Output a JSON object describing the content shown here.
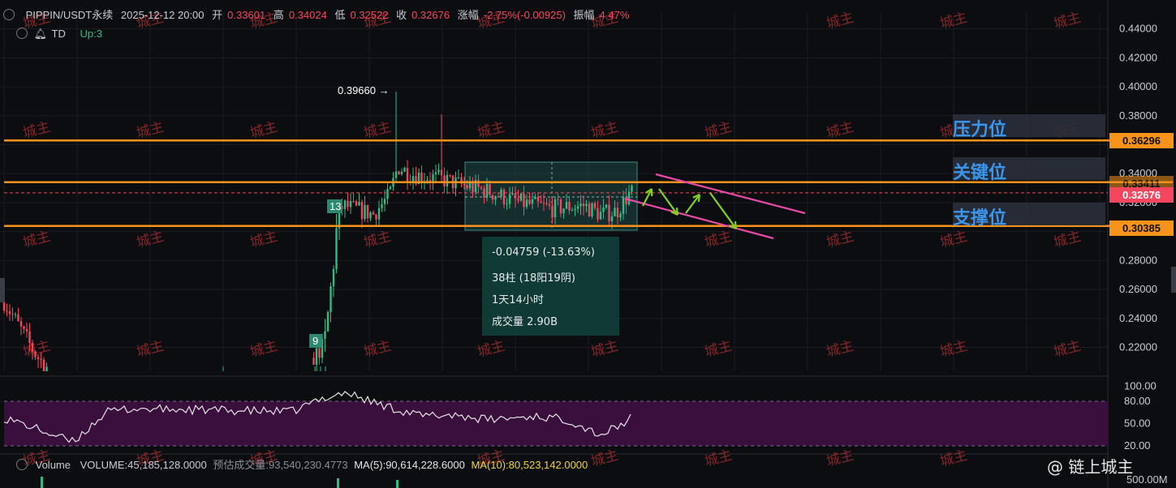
{
  "header": {
    "symbol": "PIPPIN/USDT永续",
    "datetime": "2025-12-12 20:00",
    "open_label": "开",
    "open": "0.33601",
    "high_label": "高",
    "high": "0.34024",
    "low_label": "低",
    "low": "0.32522",
    "close_label": "收",
    "close": "0.32676",
    "change_label": "涨幅",
    "change": "-2.75%(-0.00925)",
    "amp_label": "振幅",
    "amp": "4.47%"
  },
  "indicator_row": {
    "td_label": "TD",
    "td_value": "Up:3"
  },
  "stats_box": {
    "line1": "-0.04759 (-13.63%)",
    "line2": "38柱 (18阳19阴)",
    "line3": "1天14小时",
    "line4": "成交量 2.90B"
  },
  "levels": {
    "resistance_label": "压力位",
    "key_label": "关键位",
    "support_label": "支撑位",
    "resistance_price": "0.36296",
    "key_price": "0.33411",
    "current_price": "0.32676",
    "support_price": "0.30385"
  },
  "annotations": {
    "high_marker": "0.39660 →",
    "td_13": "13",
    "td_9": "9"
  },
  "volume_row": {
    "volume_label": "Volume",
    "volume_value": "VOLUME:45,185,128.0000",
    "forecast_label": "预估成交量:93,540,230.4773",
    "ma5": "MA(5):90,614,228.6000",
    "ma10": "MA(10):80,523,142.0000",
    "vol_axis": "500.00M"
  },
  "watermark": "城主",
  "brand": "@ 链上城主",
  "colors": {
    "up": "#2ebd85",
    "down": "#f6465d",
    "level": "#f7931a",
    "label_text": "#3ea2ff",
    "trend": "#e94aa8",
    "arrow": "#7fd321",
    "rsi_bg": "#3b0f3d"
  },
  "chart_data": {
    "type": "candlestick",
    "y_axis_ticks": [
      "0.44000",
      "0.42000",
      "0.40000",
      "0.38000",
      "0.36000",
      "0.34000",
      "0.32000",
      "0.30000",
      "0.28000",
      "0.26000",
      "0.24000",
      "0.22000"
    ],
    "ylim": [
      0.2035,
      0.451
    ],
    "rsi_ticks": [
      "100.00",
      "80.00",
      "50.00",
      "20.00"
    ],
    "rsi_ylim": [
      0,
      100
    ],
    "levels": [
      0.36296,
      0.33411,
      0.30385
    ],
    "current_price": 0.32676,
    "max_high": 0.3966
  }
}
